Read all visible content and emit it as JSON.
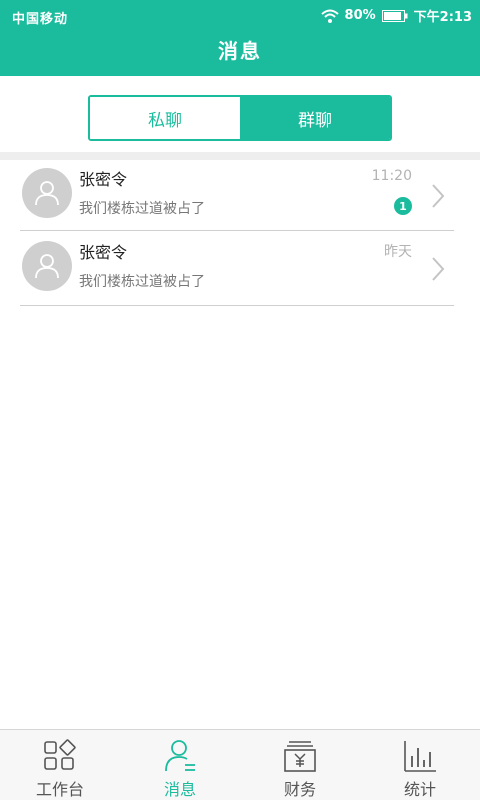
{
  "status_bar": {
    "carrier": "中国移动",
    "battery": "80%",
    "time": "下午2:13"
  },
  "header": {
    "title": "消息"
  },
  "tabs": [
    {
      "label": "私聊",
      "active": false
    },
    {
      "label": "群聊",
      "active": true
    }
  ],
  "messages": [
    {
      "name": "张密令",
      "preview": "我们楼栋过道被占了",
      "time": "11:20",
      "unread": "1"
    },
    {
      "name": "张密令",
      "preview": "我们楼栋过道被占了",
      "time": "昨天",
      "unread": ""
    }
  ],
  "bottom_nav": [
    {
      "label": "工作台",
      "icon": "workbench-icon",
      "active": false
    },
    {
      "label": "消息",
      "icon": "message-icon",
      "active": true
    },
    {
      "label": "财务",
      "icon": "finance-icon",
      "active": false
    },
    {
      "label": "统计",
      "icon": "statistics-icon",
      "active": false
    }
  ],
  "colors": {
    "accent": "#1bbc9e",
    "divider": "#cfcfcf",
    "avatar_bg": "#cfcfcf"
  }
}
